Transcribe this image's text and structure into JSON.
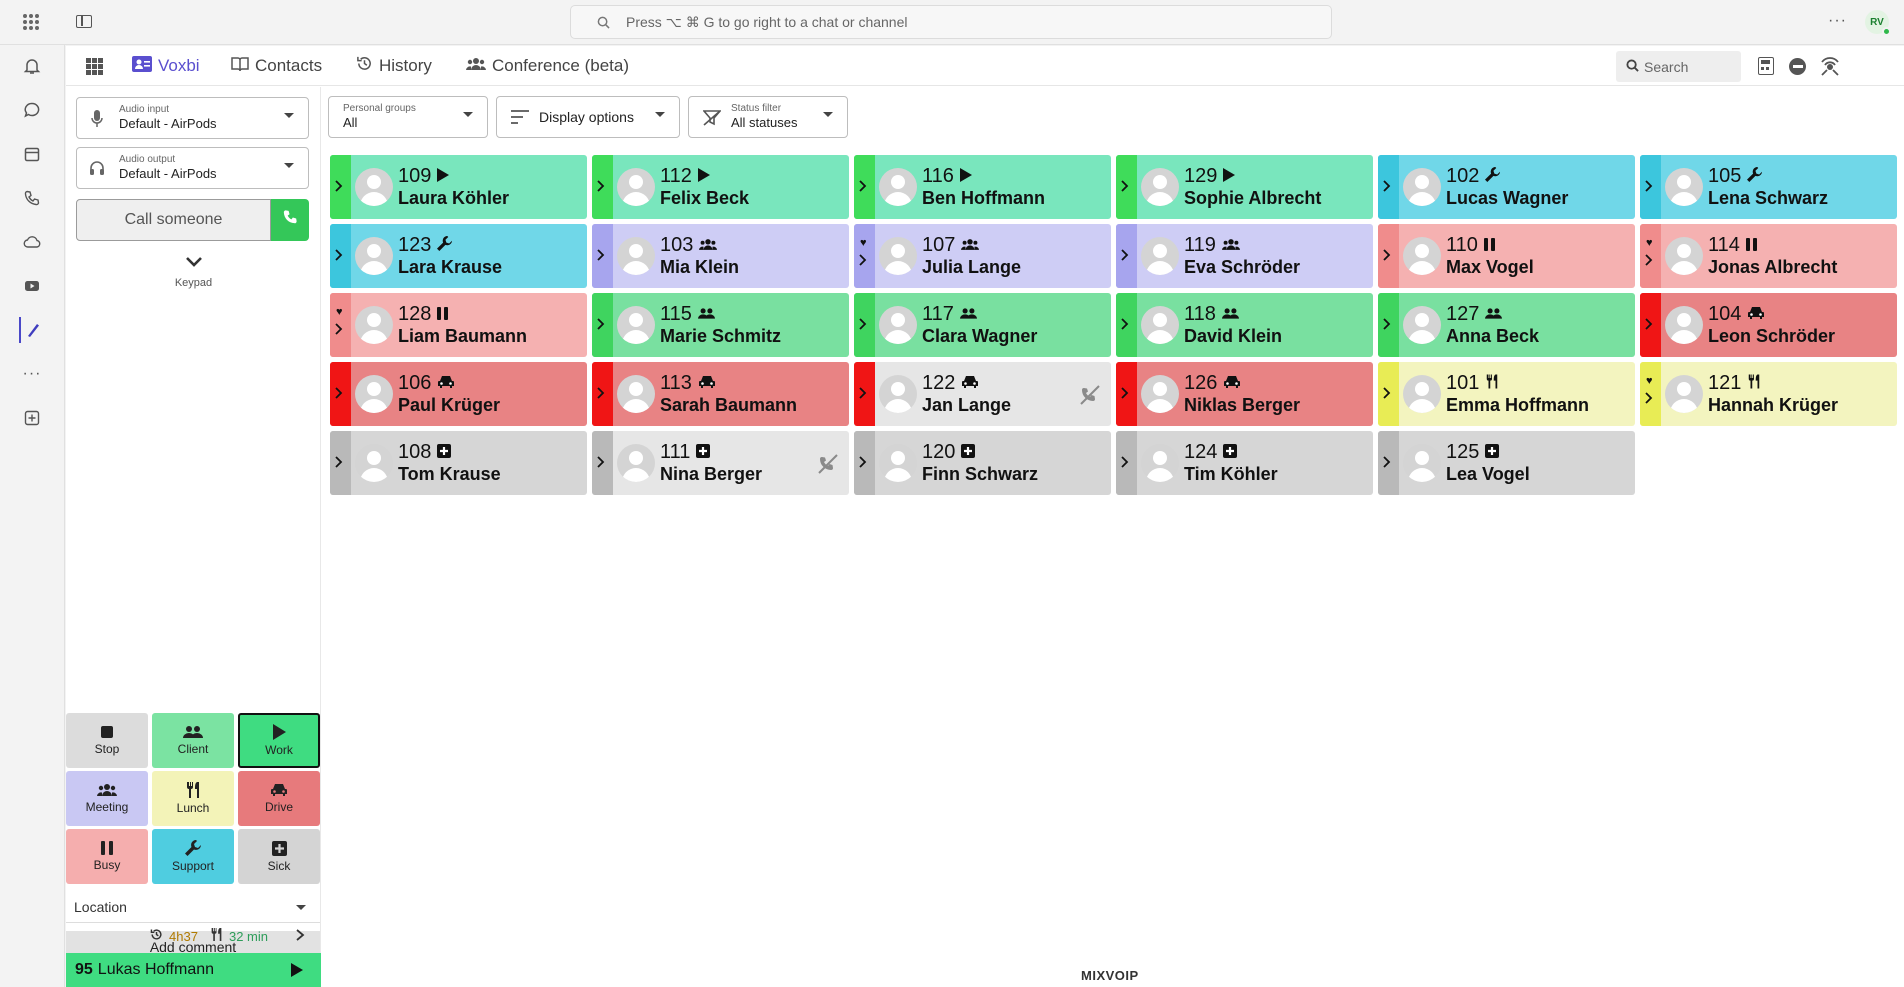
{
  "search_bar": {
    "placeholder": "Press ⌥ ⌘ G to go right to a chat or channel"
  },
  "user_initials": "RV",
  "tabs": [
    {
      "label": "Voxbi",
      "active": true
    },
    {
      "label": "Contacts"
    },
    {
      "label": "History"
    },
    {
      "label": "Conference (beta)"
    }
  ],
  "search_panel": {
    "placeholder": "Search"
  },
  "audio_input": {
    "label": "Audio input",
    "value": "Default - AirPods"
  },
  "audio_output": {
    "label": "Audio output",
    "value": "Default - AirPods"
  },
  "personal_groups": {
    "label": "Personal groups",
    "value": "All"
  },
  "display_options": {
    "label": "Display options"
  },
  "status_filter": {
    "label": "Status filter",
    "value": "All statuses"
  },
  "call_input": {
    "placeholder": "Call someone"
  },
  "keypad": {
    "label": "Keypad"
  },
  "status_buttons": [
    {
      "label": "Stop",
      "color": "#dcdcdc",
      "icon": "stop-icon"
    },
    {
      "label": "Client",
      "color": "#7be3a2",
      "icon": "users-icon"
    },
    {
      "label": "Work",
      "color": "#3fdc81",
      "icon": "play-icon"
    },
    {
      "label": "Meeting",
      "color": "#c9c8f3",
      "icon": "users-icon"
    },
    {
      "label": "Lunch",
      "color": "#f3f3b8",
      "icon": "utensils-icon"
    },
    {
      "label": "Drive",
      "color": "#e77a7c",
      "icon": "car-icon"
    },
    {
      "label": "Busy",
      "color": "#f5aeae",
      "icon": "pause-icon"
    },
    {
      "label": "Support",
      "color": "#4fcde0",
      "icon": "wrench-icon"
    },
    {
      "label": "Sick",
      "color": "#d4d4d4",
      "icon": "medkit-icon"
    }
  ],
  "location": {
    "label": "Location"
  },
  "add_comment": {
    "label": "Add comment"
  },
  "timers": {
    "work": "4h37",
    "lunch": "32 min"
  },
  "current_user": {
    "ext": "95",
    "name": "Lukas Hoffmann"
  },
  "footer_logo": "MIXVOIP",
  "colors": {
    "accent": "#5a4fcf",
    "green": "#34c759"
  },
  "contacts": [
    {
      "ext": "109",
      "name": "Laura Köhler",
      "status": "work"
    },
    {
      "ext": "112",
      "name": "Felix Beck",
      "status": "work"
    },
    {
      "ext": "116",
      "name": "Ben Hoffmann",
      "status": "work"
    },
    {
      "ext": "129",
      "name": "Sophie Albrecht",
      "status": "work"
    },
    {
      "ext": "102",
      "name": "Lucas Wagner",
      "status": "support"
    },
    {
      "ext": "105",
      "name": "Lena Schwarz",
      "status": "support"
    },
    {
      "ext": "123",
      "name": "Lara Krause",
      "status": "support"
    },
    {
      "ext": "103",
      "name": "Mia Klein",
      "status": "meeting"
    },
    {
      "ext": "107",
      "name": "Julia Lange",
      "status": "meeting",
      "fav": true
    },
    {
      "ext": "119",
      "name": "Eva Schröder",
      "status": "meeting"
    },
    {
      "ext": "110",
      "name": "Max Vogel",
      "status": "busy"
    },
    {
      "ext": "114",
      "name": "Jonas Albrecht",
      "status": "busy",
      "fav": true
    },
    {
      "ext": "128",
      "name": "Liam Baumann",
      "status": "busy",
      "fav": true
    },
    {
      "ext": "115",
      "name": "Marie Schmitz",
      "status": "client"
    },
    {
      "ext": "117",
      "name": "Clara Wagner",
      "status": "client"
    },
    {
      "ext": "118",
      "name": "David Klein",
      "status": "client"
    },
    {
      "ext": "127",
      "name": "Anna Beck",
      "status": "client"
    },
    {
      "ext": "104",
      "name": "Leon Schröder",
      "status": "drive"
    },
    {
      "ext": "106",
      "name": "Paul Krüger",
      "status": "drive"
    },
    {
      "ext": "113",
      "name": "Sarah Baumann",
      "status": "drive"
    },
    {
      "ext": "122",
      "name": "Jan Lange",
      "status": "drive-off",
      "muted": true
    },
    {
      "ext": "126",
      "name": "Niklas Berger",
      "status": "drive"
    },
    {
      "ext": "101",
      "name": "Emma Hoffmann",
      "status": "lunch"
    },
    {
      "ext": "121",
      "name": "Hannah Krüger",
      "status": "lunch",
      "fav": true
    },
    {
      "ext": "108",
      "name": "Tom Krause",
      "status": "sick"
    },
    {
      "ext": "111",
      "name": "Nina Berger",
      "status": "sick-off",
      "muted": true
    },
    {
      "ext": "120",
      "name": "Finn Schwarz",
      "status": "sick"
    },
    {
      "ext": "124",
      "name": "Tim Köhler",
      "status": "sick"
    },
    {
      "ext": "125",
      "name": "Lea Vogel",
      "status": "sick"
    }
  ]
}
